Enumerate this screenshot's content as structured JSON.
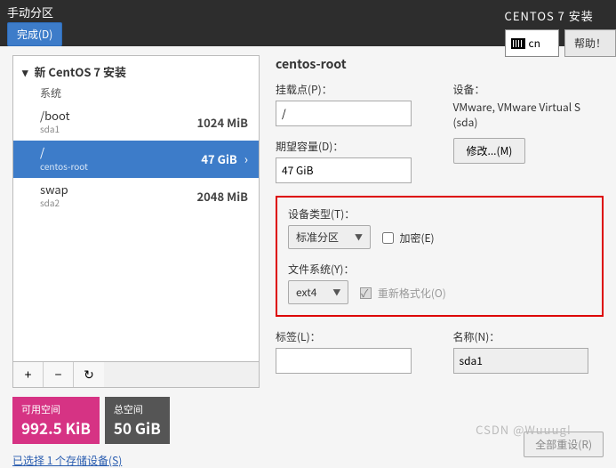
{
  "header": {
    "title": "手动分区",
    "done_label": "完成(D)",
    "installer_title": "CENTOS 7 安装",
    "lang": "cn",
    "help_label": "帮助！"
  },
  "tree": {
    "root_label": "新 CentOS 7 安装",
    "system_label": "系统",
    "partitions": [
      {
        "mount": "/boot",
        "device": "sda1",
        "size": "1024 MiB"
      },
      {
        "mount": "/",
        "device": "centos-root",
        "size": "47 GiB"
      },
      {
        "mount": "swap",
        "device": "sda2",
        "size": "2048 MiB"
      }
    ]
  },
  "toolbar": {
    "add": "+",
    "remove": "−",
    "reload": "↻"
  },
  "space": {
    "avail_label": "可用空间",
    "avail_value": "992.5 KiB",
    "total_label": "总空间",
    "total_value": "50 GiB"
  },
  "storage_link": "已选择 1 个存储设备(S)",
  "details": {
    "name": "centos-root",
    "mount_label": "挂载点(P)：",
    "mount_value": "/",
    "capacity_label": "期望容量(D)：",
    "capacity_value": "47 GiB",
    "device_label": "设备：",
    "device_text": "VMware, VMware Virtual S (sda)",
    "modify_label": "修改...(M)",
    "devtype_label": "设备类型(T)：",
    "devtype_value": "标准分区",
    "encrypt_label": "加密(E)",
    "fs_label": "文件系统(Y)：",
    "fs_value": "ext4",
    "reformat_label": "重新格式化(O)",
    "label_label": "标签(L)：",
    "label_value": "",
    "namefield_label": "名称(N)：",
    "namefield_value": "sda1"
  },
  "reset_label": "全部重设(R)",
  "watermark": "CSDN @Wuuug!"
}
